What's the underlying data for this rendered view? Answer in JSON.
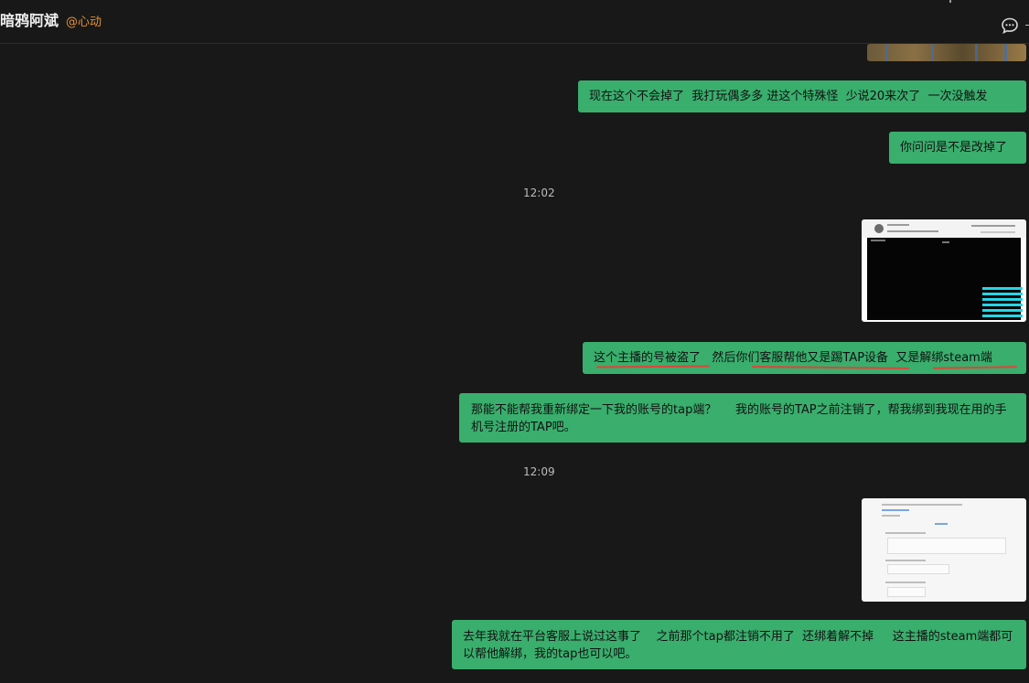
{
  "header": {
    "title": "暗鸦阿斌",
    "subtitle": "@心动"
  },
  "messages": {
    "m1": "现在这个不会掉了  我打玩偶多多 进这个特殊怪  少说20来次了  一次没触发",
    "m2": "你问问是不是改掉了",
    "ts1": "12:02",
    "m3": "这个主播的号被盗了   然后你们客服帮他又是踢TAP设备  又是解绑steam端",
    "m4": "那能不能帮我重新绑定一下我的账号的tap端？     我的账号的TAP之前注销了，帮我绑到我现在用的手机号注册的TAP吧。",
    "ts2": "12:09",
    "m5": "去年我就在平台客服上说过这事了    之前那个tap都注销不用了  还绑着解不掉     这主播的steam端都可以帮他解绑，我的tap也可以吧。"
  },
  "icons": {
    "chat": "chat-bubble-icon"
  },
  "colors": {
    "bubble": "#3aae6d",
    "accent": "#e0913a",
    "underline": "#e0443b"
  }
}
